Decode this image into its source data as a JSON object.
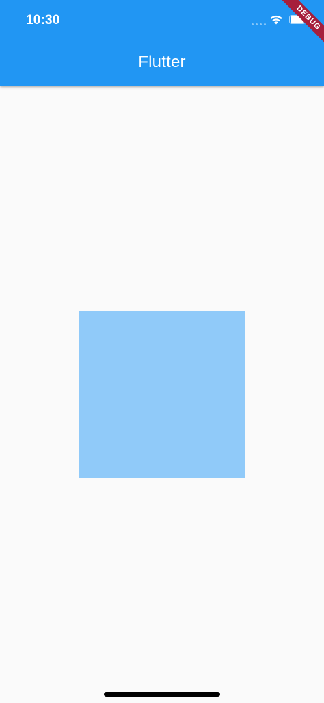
{
  "status_bar": {
    "time": "10:30",
    "signal_icon": "cellular-signal-icon",
    "wifi_icon": "wifi-icon",
    "battery_icon": "battery-icon"
  },
  "app_bar": {
    "title": "Flutter",
    "color": "#2196f3"
  },
  "debug_banner": {
    "label": "DEBUG",
    "color": "#a61f3c"
  },
  "body": {
    "background": "#fafafa",
    "box_color": "#90caf9"
  }
}
